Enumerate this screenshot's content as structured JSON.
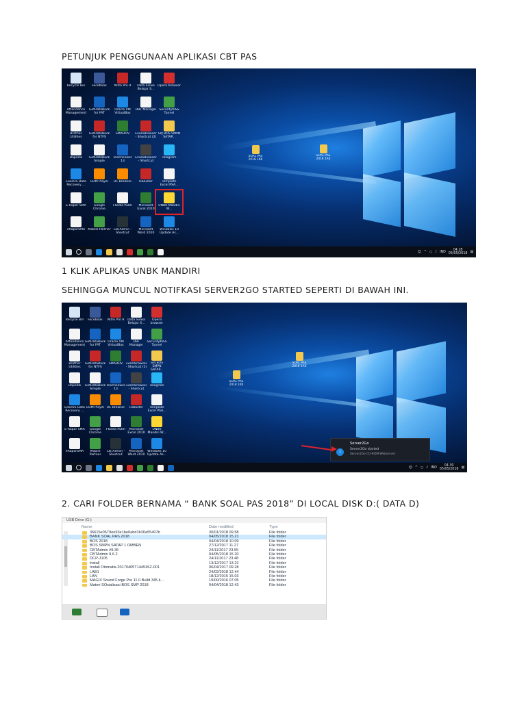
{
  "title": "PETUNJUK PENGGUNAAN APLIKASI CBT PAS",
  "step1": "1 KLIK APLIKAS UNBK MANDIRI",
  "step1_note": "SEHINGGA MUNCUL NOTIFKASI SERVER2GO STARTED SEPERTI DI BAWAH INI.",
  "step2": "2. CARI FOLDER BERNAMA “ BANK SOAL PAS 2018” DI LOCAL DISK D:( DATA D)",
  "desktop": {
    "icons": [
      {
        "label": "Recycle Bin",
        "color": "#d7e6f5"
      },
      {
        "label": "Facebook",
        "color": "#3b5998"
      },
      {
        "label": "Nitro Pro 9",
        "color": "#c62828"
      },
      {
        "label": "Data Siswa Belajar S...",
        "color": "#f5f5f5"
      },
      {
        "label": "Opera browser",
        "color": "#d32f2f"
      },
      {
        "label": "Attendance Management",
        "color": "#f5f5f5"
      },
      {
        "label": "GetDataBack for FAT",
        "color": "#1565c0"
      },
      {
        "label": "Oracle VM VirtualBox",
        "color": "#1e88e5"
      },
      {
        "label": "DBF Manager",
        "color": "#f5f5f5"
      },
      {
        "label": "SecurityKISS Tunnel",
        "color": "#43a047"
      },
      {
        "label": "Brother Utilities",
        "color": "#f5f5f5"
      },
      {
        "label": "GetDataBack for NTFS",
        "color": "#c62828"
      },
      {
        "label": "SMADOV",
        "color": "#2e7d32"
      },
      {
        "label": "ExamBrowser - Shortcut (2)",
        "color": "#c62828"
      },
      {
        "label": "SPJ BOS SMPN SATAP...",
        "color": "#f2c94c"
      },
      {
        "label": "Dapodik",
        "color": "#f5f5f5"
      },
      {
        "label": "GetDataBack Simple",
        "color": "#f5f5f5"
      },
      {
        "label": "TeamViewer 13",
        "color": "#1565c0"
      },
      {
        "label": "ExamBrowser - Shortcut",
        "color": "#424242"
      },
      {
        "label": "Telegram",
        "color": "#29b6f6"
      },
      {
        "label": "EaseUS Data Recovery ...",
        "color": "#1e88e5"
      },
      {
        "label": "GOM Player",
        "color": "#fb8c00"
      },
      {
        "label": "UC Browser",
        "color": "#fb8c00"
      },
      {
        "label": "IsiBuster",
        "color": "#c62828"
      },
      {
        "label": "Template Excel PSA...",
        "color": "#f5f5f5"
      },
      {
        "label": "E-Rapor SMA",
        "color": "#f5f5f5"
      },
      {
        "label": "Google Chrome",
        "color": "#43a047"
      },
      {
        "label": "Fkodia Putih",
        "color": "#f5f5f5"
      },
      {
        "label": "Microsoft Excel 2010",
        "color": "#2e7d32"
      },
      {
        "label": "UNBK Mandiri W...",
        "color": "#fdd835"
      },
      {
        "label": "eRaporSMA",
        "color": "#f5f5f5"
      },
      {
        "label": "Mobile Partner",
        "color": "#43a047"
      },
      {
        "label": "CBTAdmin - Shortcut",
        "color": "#263238"
      },
      {
        "label": "Microsoft Word 2010",
        "color": "#1565c0"
      },
      {
        "label": "Windows 10 Update As...",
        "color": "#1e88e5"
      }
    ],
    "file_label_1": "SOAL PAS 2018 1AK",
    "file_label_2": "SOAL PAS 2018 1KK",
    "tray_lang": "IND",
    "clock_time_1": "04.28",
    "clock_date_1": "05/05/2018",
    "clock_time_2": "04.30",
    "clock_date_2": "05/05/2018"
  },
  "notification": {
    "title": "Server2Go",
    "line1": "Server2Go started",
    "line2": "Server2Go CD-ROM-Webserver"
  },
  "explorer": {
    "drive": "USB Drive (G:)",
    "headers": {
      "name": "Name",
      "date": "Date modified",
      "type": "Type"
    },
    "rows": [
      {
        "name": "36615e0579ee93e1be0abd1b30a55407b",
        "date": "30/01/2018 09.58",
        "type": "File folder"
      },
      {
        "name": "BANK SOAL PAS 2018",
        "date": "04/05/2018 15.21",
        "type": "File folder"
      },
      {
        "name": "BOS 2018",
        "date": "04/04/2018 10.09",
        "type": "File folder"
      },
      {
        "name": "BOS SMPN SATAP 1 OMBEN",
        "date": "27/12/2017 11.27",
        "type": "File folder"
      },
      {
        "name": "CBTAdmin #9.35",
        "date": "24/11/2017 23.55",
        "type": "File folder"
      },
      {
        "name": "CBTAdmin 9.6.2",
        "date": "04/05/2018 15.20",
        "type": "File folder"
      },
      {
        "name": "DCP-J105",
        "date": "24/11/2017 23.48",
        "type": "File folder"
      },
      {
        "name": "install",
        "date": "13/12/2017 13.22",
        "type": "File folder"
      },
      {
        "name": "Install Otomatis-20170405T144536Z-001",
        "date": "06/04/2017 09.28",
        "type": "File folder"
      },
      {
        "name": "LAB1",
        "date": "24/02/2018 12.44",
        "type": "File folder"
      },
      {
        "name": "LAN",
        "date": "18/12/2015 15.03",
        "type": "File folder"
      },
      {
        "name": "MAGIX Sound Forge Pro 11.0 Build 345.k...",
        "date": "19/09/2016 07.05",
        "type": "File folder"
      },
      {
        "name": "Materi SOsialisasi BOS SMP 2018",
        "date": "04/04/2018 12.43",
        "type": "File folder"
      }
    ]
  }
}
